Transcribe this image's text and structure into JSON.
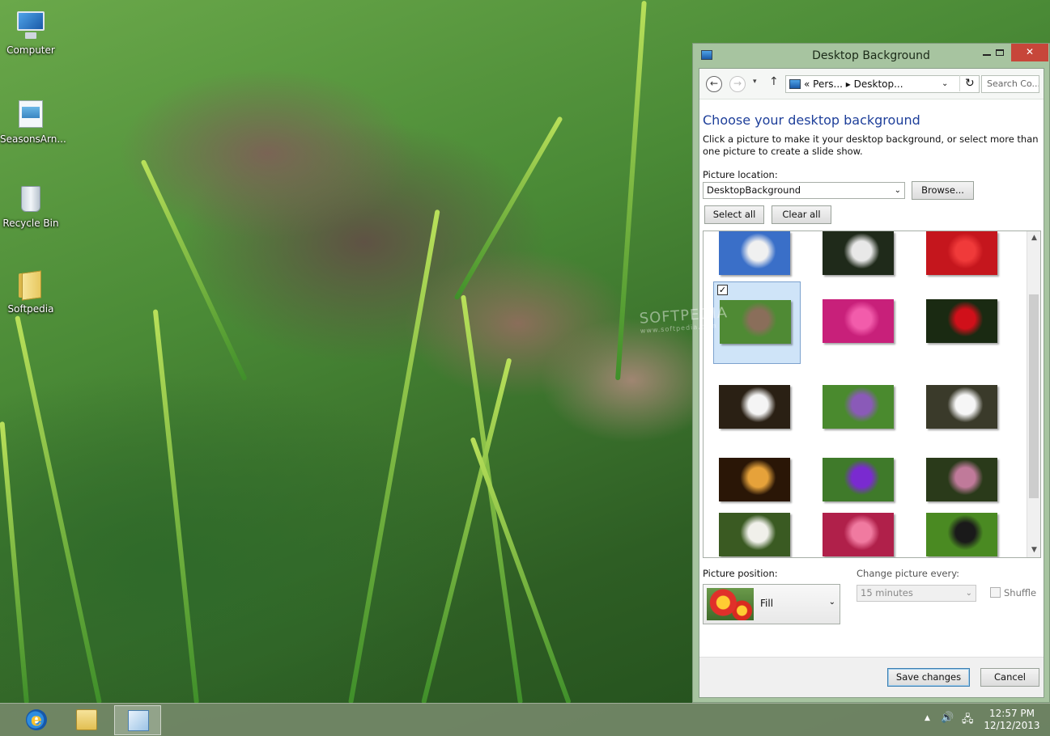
{
  "desktop": {
    "icons": [
      {
        "label": "Computer",
        "icon": "computer-icon"
      },
      {
        "label": "SeasonsArn...",
        "icon": "seasons-theme-icon"
      },
      {
        "label": "Recycle Bin",
        "icon": "recycle-bin-icon"
      },
      {
        "label": "Softpedia",
        "icon": "folder-icon"
      }
    ],
    "watermark": "SOFTPEDIA",
    "watermark_sub": "www.softpedia.com"
  },
  "window": {
    "title": "Desktop Background",
    "controls": {
      "minimize": "minimize",
      "maximize": "maximize",
      "close": "✕"
    },
    "nav": {
      "back": "←",
      "forward": "→",
      "recent": "▾",
      "up": "↑",
      "address": "« Pers... ▸ Desktop...",
      "address_chevron": "⌄",
      "refresh": "↻",
      "search_placeholder": "Search Co..."
    },
    "heading": "Choose your desktop background",
    "description": "Click a picture to make it your desktop background, or select more than one picture to create a slide show.",
    "picture_location_label": "Picture location:",
    "picture_location_value": "DesktopBackground",
    "browse_label": "Browse...",
    "select_all_label": "Select all",
    "clear_all_label": "Clear all",
    "thumbnails": [
      {
        "subject": "white-daisy-blue-sky",
        "colors": [
          "#3a6fc8",
          "#f0f0f0"
        ],
        "selected": false
      },
      {
        "subject": "white-flower-dark",
        "colors": [
          "#1f2a1a",
          "#e8e8e8"
        ],
        "selected": false
      },
      {
        "subject": "red-dahlia",
        "colors": [
          "#c5161d",
          "#f03a3a"
        ],
        "selected": false
      },
      {
        "subject": "mushrooms-grass",
        "colors": [
          "#4f8a34",
          "#8a6e5a"
        ],
        "selected": true
      },
      {
        "subject": "pink-dahlia",
        "colors": [
          "#c8207a",
          "#f25cab"
        ],
        "selected": false
      },
      {
        "subject": "red-cherry",
        "colors": [
          "#1a2a12",
          "#d0101a"
        ],
        "selected": false
      },
      {
        "subject": "white-blossoms",
        "colors": [
          "#2a2014",
          "#f4f4f4"
        ],
        "selected": false
      },
      {
        "subject": "purple-flowers-meadow",
        "colors": [
          "#4a8a2e",
          "#8a5ab8"
        ],
        "selected": false
      },
      {
        "subject": "white-anemone",
        "colors": [
          "#3a3a2a",
          "#f6f6f6"
        ],
        "selected": false
      },
      {
        "subject": "orange-mushrooms",
        "colors": [
          "#2a1606",
          "#e6a23a"
        ],
        "selected": false
      },
      {
        "subject": "purple-cornflower",
        "colors": [
          "#3f7a2a",
          "#7a2ad0"
        ],
        "selected": false
      },
      {
        "subject": "pink-wildflowers",
        "colors": [
          "#2a3a1a",
          "#c07a9a"
        ],
        "selected": false
      },
      {
        "subject": "white-clover",
        "colors": [
          "#3a5a22",
          "#f0f0ea"
        ],
        "selected": false
      },
      {
        "subject": "pink-flower-closeup",
        "colors": [
          "#b0204a",
          "#f07aa0"
        ],
        "selected": false
      },
      {
        "subject": "butterfly-on-flowers",
        "colors": [
          "#4a8a22",
          "#1a1a1a"
        ],
        "selected": false
      }
    ],
    "selected_check": "✓",
    "scroll_up": "▲",
    "scroll_down": "▼",
    "picture_position_label": "Picture position:",
    "picture_position_value": "Fill",
    "change_every_label": "Change picture every:",
    "change_every_value": "15 minutes",
    "shuffle_label": "Shuffle",
    "shuffle_checked": false,
    "save_label": "Save changes",
    "cancel_label": "Cancel"
  },
  "taskbar": {
    "buttons": [
      {
        "name": "internet-explorer",
        "glyph": "e",
        "active": false
      },
      {
        "name": "file-explorer",
        "glyph": "",
        "active": false
      },
      {
        "name": "control-panel",
        "glyph": "",
        "active": true
      }
    ],
    "tray": {
      "chevron": "▲",
      "volume": "🔊",
      "network": "🖧"
    },
    "time": "12:57 PM",
    "date": "12/12/2013"
  }
}
